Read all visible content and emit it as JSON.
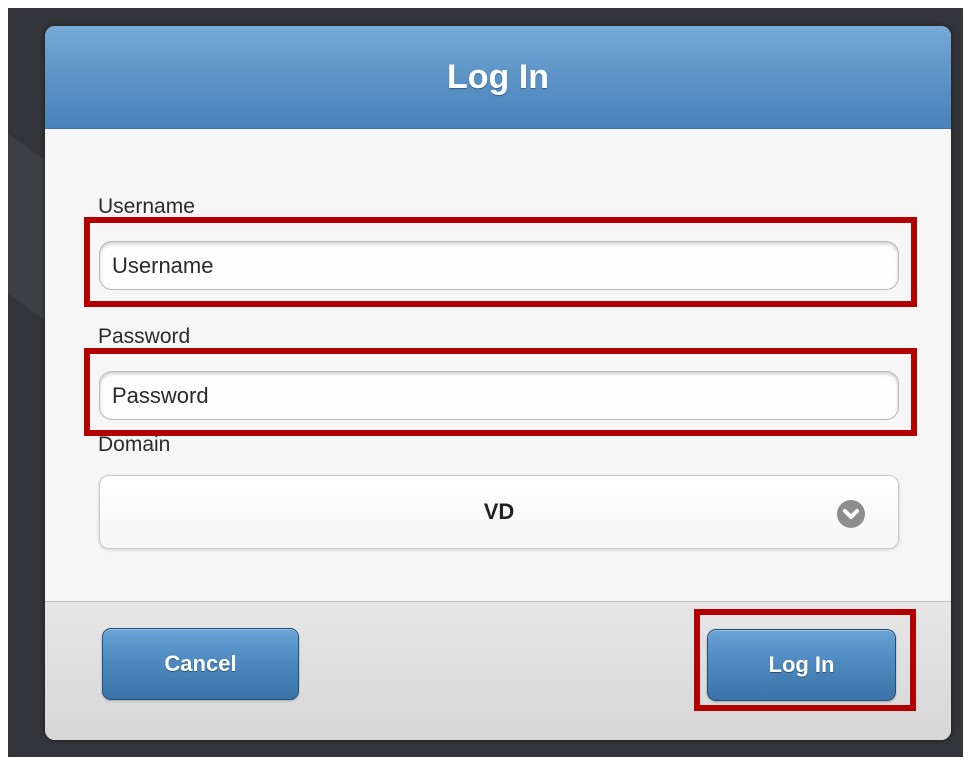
{
  "dialog": {
    "title": "Log In"
  },
  "form": {
    "username": {
      "label": "Username",
      "placeholder": "Username",
      "value": ""
    },
    "password": {
      "label": "Password",
      "placeholder": "Password",
      "value": ""
    },
    "domain": {
      "label": "Domain",
      "selected": "VD",
      "icon": "chevron-down-circle-icon"
    }
  },
  "buttons": {
    "cancel_label": "Cancel",
    "login_label": "Log In"
  },
  "colors": {
    "header_blue": "#5b93c6",
    "button_blue": "#4e8ac0",
    "highlight_red": "#b30000",
    "backdrop": "#34353a"
  }
}
